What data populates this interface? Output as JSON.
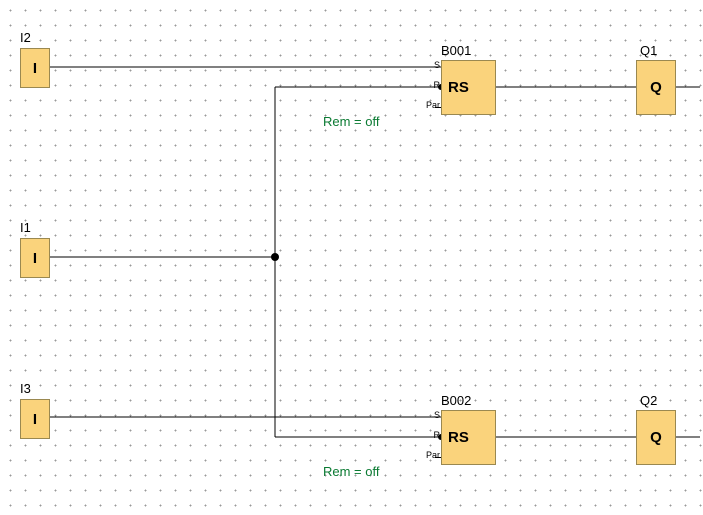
{
  "blocks": {
    "i2": {
      "label": "I2",
      "text": "I"
    },
    "i1": {
      "label": "I1",
      "text": "I"
    },
    "i3": {
      "label": "I3",
      "text": "I"
    },
    "b001": {
      "label": "B001",
      "text": "RS",
      "ports": {
        "s": "S",
        "r": "R",
        "par": "Par"
      },
      "param": "Rem = off"
    },
    "b002": {
      "label": "B002",
      "text": "RS",
      "ports": {
        "s": "S",
        "r": "R",
        "par": "Par"
      },
      "param": "Rem = off"
    },
    "q1": {
      "label": "Q1",
      "text": "Q"
    },
    "q2": {
      "label": "Q2",
      "text": "Q"
    }
  }
}
